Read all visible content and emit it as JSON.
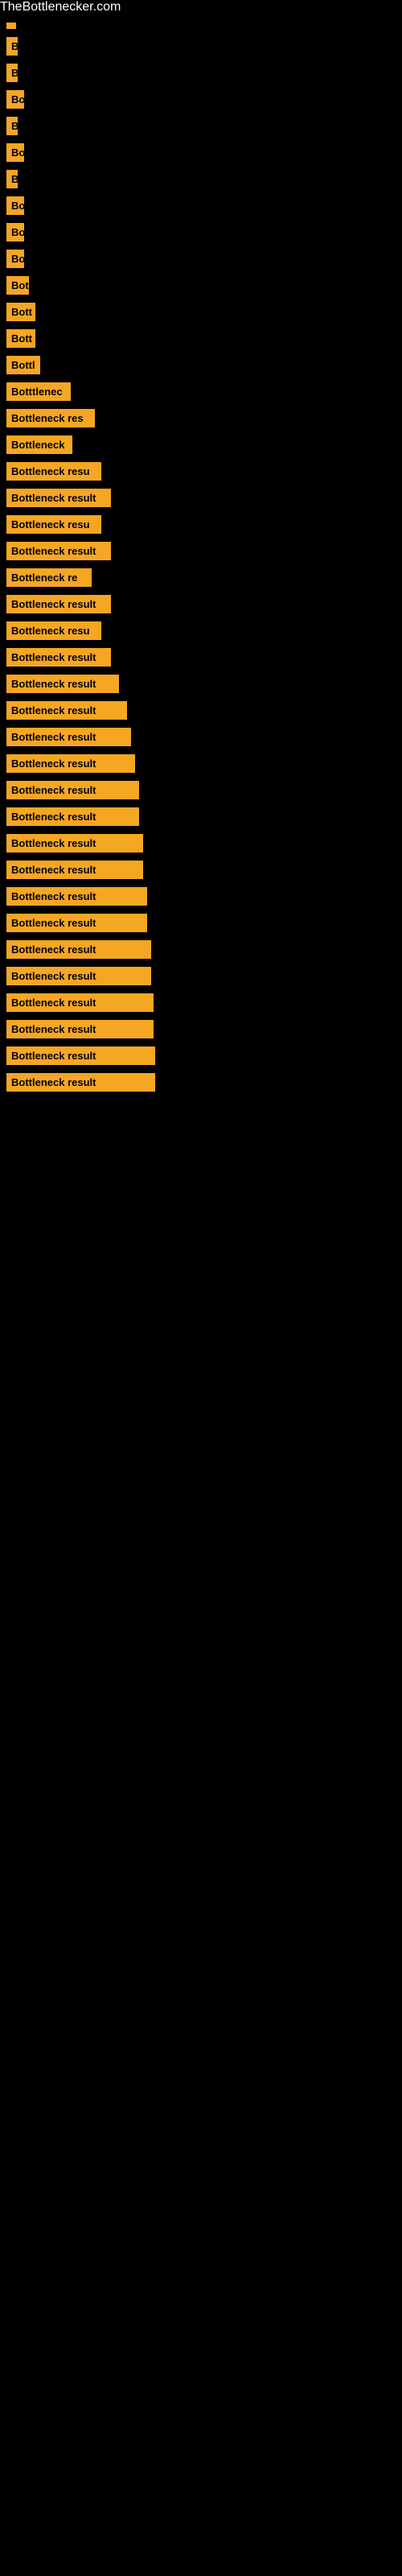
{
  "site": {
    "title": "TheBottlenecker.com"
  },
  "items": [
    {
      "id": 1,
      "label": "",
      "width": 8
    },
    {
      "id": 2,
      "label": "B",
      "width": 14
    },
    {
      "id": 3,
      "label": "B",
      "width": 14
    },
    {
      "id": 4,
      "label": "Bo",
      "width": 22
    },
    {
      "id": 5,
      "label": "B",
      "width": 14
    },
    {
      "id": 6,
      "label": "Bo",
      "width": 22
    },
    {
      "id": 7,
      "label": "B",
      "width": 14
    },
    {
      "id": 8,
      "label": "Bo",
      "width": 22
    },
    {
      "id": 9,
      "label": "Bo",
      "width": 22
    },
    {
      "id": 10,
      "label": "Bo",
      "width": 22
    },
    {
      "id": 11,
      "label": "Bot",
      "width": 28
    },
    {
      "id": 12,
      "label": "Bott",
      "width": 36
    },
    {
      "id": 13,
      "label": "Bott",
      "width": 36
    },
    {
      "id": 14,
      "label": "Bottl",
      "width": 42
    },
    {
      "id": 15,
      "label": "Botttlenec",
      "width": 80
    },
    {
      "id": 16,
      "label": "Bottleneck res",
      "width": 110
    },
    {
      "id": 17,
      "label": "Bottleneck",
      "width": 82
    },
    {
      "id": 18,
      "label": "Bottleneck resu",
      "width": 118
    },
    {
      "id": 19,
      "label": "Bottleneck result",
      "width": 130
    },
    {
      "id": 20,
      "label": "Bottleneck resu",
      "width": 118
    },
    {
      "id": 21,
      "label": "Bottleneck result",
      "width": 130
    },
    {
      "id": 22,
      "label": "Bottleneck re",
      "width": 106
    },
    {
      "id": 23,
      "label": "Bottleneck result",
      "width": 130
    },
    {
      "id": 24,
      "label": "Bottleneck resu",
      "width": 118
    },
    {
      "id": 25,
      "label": "Bottleneck result",
      "width": 130
    },
    {
      "id": 26,
      "label": "Bottleneck result",
      "width": 140
    },
    {
      "id": 27,
      "label": "Bottleneck result",
      "width": 150
    },
    {
      "id": 28,
      "label": "Bottleneck result",
      "width": 155
    },
    {
      "id": 29,
      "label": "Bottleneck result",
      "width": 160
    },
    {
      "id": 30,
      "label": "Bottleneck result",
      "width": 165
    },
    {
      "id": 31,
      "label": "Bottleneck result",
      "width": 165
    },
    {
      "id": 32,
      "label": "Bottleneck result",
      "width": 170
    },
    {
      "id": 33,
      "label": "Bottleneck result",
      "width": 170
    },
    {
      "id": 34,
      "label": "Bottleneck result",
      "width": 175
    },
    {
      "id": 35,
      "label": "Bottleneck result",
      "width": 175
    },
    {
      "id": 36,
      "label": "Bottleneck result",
      "width": 180
    },
    {
      "id": 37,
      "label": "Bottleneck result",
      "width": 180
    },
    {
      "id": 38,
      "label": "Bottleneck result",
      "width": 183
    },
    {
      "id": 39,
      "label": "Bottleneck result",
      "width": 183
    },
    {
      "id": 40,
      "label": "Bottleneck result",
      "width": 185
    },
    {
      "id": 41,
      "label": "Bottleneck result",
      "width": 185
    }
  ]
}
